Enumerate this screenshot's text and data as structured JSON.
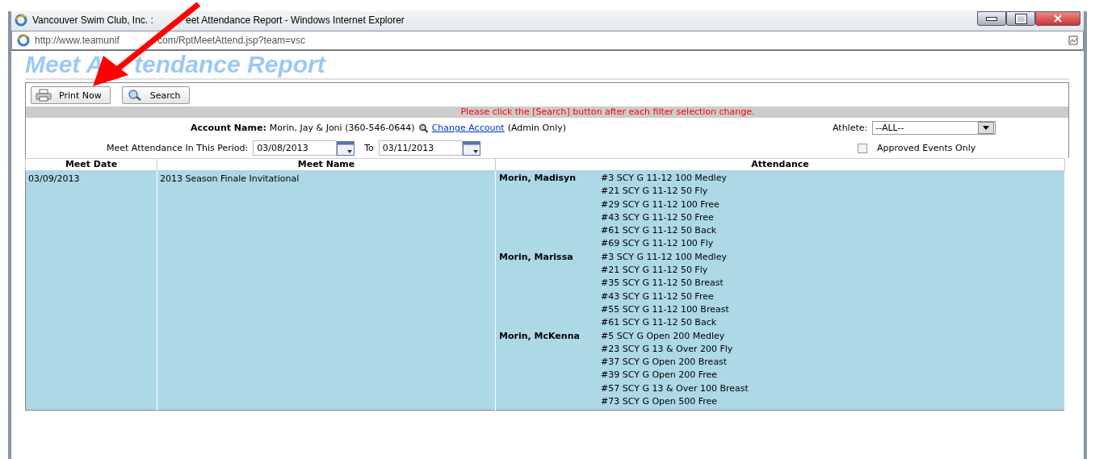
{
  "window": {
    "title": [
      "Vancouver Swim Club, Inc. :",
      "eet Attendance Report - Windows Internet Explorer"
    ],
    "address": [
      "http://www.teamunif",
      "com/RptMeetAttend.jsp?team=vsc"
    ]
  },
  "page_title": [
    "Meet A",
    "tendance Report"
  ],
  "toolbar": [
    "Print Now",
    "Search"
  ],
  "notice": "Please click the [Search] button after each filter selection change.",
  "filters": {
    "account_label": "Account Name:",
    "account_value": "Morin, Jay & Joni (360-546-0644)",
    "change_link": "Change Account",
    "admin_note": "(Admin Only)",
    "athlete_label": "Athlete:",
    "athlete_value": "--ALL--",
    "period_label": "Meet Attendance In This Period:",
    "from": "03/08/2013",
    "to_label": "To",
    "to": "03/11/2013",
    "approved_label": "Approved Events Only",
    "approved_checked": false
  },
  "table": {
    "columns": [
      "Meet Date",
      "Meet Name",
      "Attendance"
    ],
    "rows": [
      {
        "date": "03/09/2013",
        "meet": "2013 Season Finale Invitational",
        "athletes": [
          {
            "name": "Morin, Madisyn",
            "events": [
              "#3 SCY G 11-12 100 Medley",
              "#21 SCY G 11-12 50 Fly",
              "#29 SCY G 11-12 100 Free",
              "#43 SCY G 11-12 50 Free",
              "#61 SCY G 11-12 50 Back",
              "#69 SCY G 11-12 100 Fly"
            ]
          },
          {
            "name": "Morin, Marissa",
            "events": [
              "#3 SCY G 11-12 100 Medley",
              "#21 SCY G 11-12 50 Fly",
              "#35 SCY G 11-12 50 Breast",
              "#43 SCY G 11-12 50 Free",
              "#55 SCY G 11-12 100 Breast",
              "#61 SCY G 11-12 50 Back"
            ]
          },
          {
            "name": "Morin, McKenna",
            "events": [
              "#5 SCY G Open 200 Medley",
              "#23 SCY G 13 & Over 200 Fly",
              "#37 SCY G Open 200 Breast",
              "#39 SCY G Open 200 Free",
              "#57 SCY G 13 & Over 100 Breast",
              "#73 SCY G Open 500 Free"
            ]
          }
        ]
      }
    ]
  }
}
